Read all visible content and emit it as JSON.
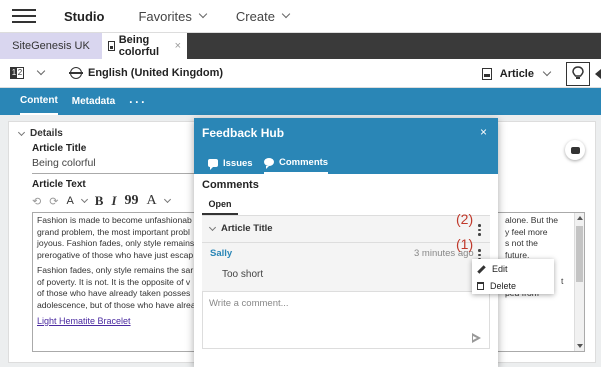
{
  "topbar": {
    "brand": "Studio",
    "menus": [
      {
        "label": "Favorites"
      },
      {
        "label": "Create"
      }
    ]
  },
  "tabs": {
    "site": "SiteGenesis UK",
    "document": "Being colorful",
    "close_glyph": "×"
  },
  "toolbar": {
    "split_left": "1",
    "split_right": "2",
    "language": "English (United Kingdom)",
    "doc_type": "Article",
    "bulb_icon": "lightbulb-icon"
  },
  "content_tabs": {
    "items": [
      "Content",
      "Metadata"
    ],
    "more": "···",
    "active": "Content"
  },
  "details": {
    "header": "Details",
    "article_title_label": "Article Title",
    "article_title_value": "Being colorful",
    "article_text_label": "Article Text",
    "rte_toolbar": {
      "undo": "⟲",
      "redo": "⟳",
      "style": "A",
      "bold": "B",
      "italic": "I",
      "quote": "99",
      "font": "A"
    },
    "text_left": [
      "Fashion is made to become unfashionab",
      "grand problem, the most important probl",
      "joyous. Fashion fades, only style remains",
      "prerogative of those who have just escap"
    ],
    "text_left_2": [
      "Fashion fades, only style remains the sar",
      "of poverty. It is not. It is the opposite of v",
      "of those who have already taken posses",
      "adolescence, but of those who have alrea"
    ],
    "text_right": [
      "alone. But the",
      "y feel more",
      "s not the",
      "future."
    ],
    "text_right_2": [
      "t",
      "ped from"
    ],
    "link": "Light Hematite Bracelet"
  },
  "feedback_hub": {
    "title": "Feedback Hub",
    "close": "×",
    "tabs": [
      "Issues",
      "Comments"
    ],
    "active_tab": "Comments",
    "section_title": "Comments",
    "filter_tab": "Open",
    "thread": {
      "title": "Article Title",
      "author": "Sally",
      "time": "3 minutes ago",
      "text": "Too short"
    },
    "reply_placeholder": "Write a comment..."
  },
  "annotations": {
    "label_2": "(2)",
    "label_1": "(1)",
    "color": "#c0392b"
  },
  "context_menu": {
    "items": [
      "Edit",
      "Delete"
    ]
  },
  "colors": {
    "primary_blue": "#2a86b6",
    "site_tab": "#d9d6ef",
    "link": "#4a2aa0"
  }
}
